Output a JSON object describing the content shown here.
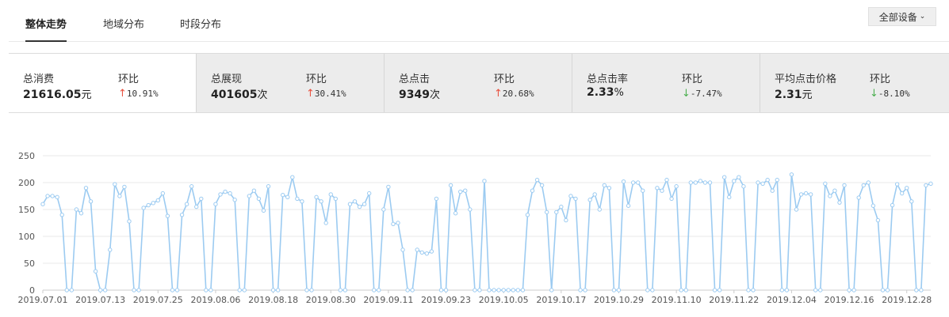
{
  "tabs": [
    {
      "label": "整体走势",
      "active": true
    },
    {
      "label": "地域分布",
      "active": false
    },
    {
      "label": "时段分布",
      "active": false
    }
  ],
  "device_filter": {
    "label": "全部设备",
    "icon": "chevron-down-icon"
  },
  "metrics": [
    {
      "label": "总消费",
      "value": "21616.05",
      "unit": "元",
      "ratio_label": "环比",
      "direction": "up",
      "change": "10.91%",
      "active": true
    },
    {
      "label": "总展现",
      "value": "401605",
      "unit": "次",
      "ratio_label": "环比",
      "direction": "up",
      "change": "30.41%",
      "active": false
    },
    {
      "label": "总点击",
      "value": "9349",
      "unit": "次",
      "ratio_label": "环比",
      "direction": "up",
      "change": "20.68%",
      "active": false
    },
    {
      "label": "总点击率",
      "value": "2.33",
      "unit": "%",
      "ratio_label": "环比",
      "direction": "down",
      "change": "-7.47%",
      "active": false
    },
    {
      "label": "平均点击价格",
      "value": "2.31",
      "unit": "元",
      "ratio_label": "环比",
      "direction": "down",
      "change": "-8.10%",
      "active": false
    }
  ],
  "colors": {
    "line": "#9ccbf1",
    "up": "#e8513f",
    "down": "#4caf50",
    "grid": "#e9e9e9"
  },
  "chart_data": {
    "type": "line",
    "title": "",
    "xlabel": "",
    "ylabel": "",
    "ylim": [
      0,
      250
    ],
    "yticks": [
      0,
      50,
      100,
      150,
      200,
      250
    ],
    "grid": true,
    "x_start": "2019.07.01",
    "x_tick_labels": [
      "2019.07.01",
      "2019.07.13",
      "2019.07.25",
      "2019.08.06",
      "2019.08.18",
      "2019.08.30",
      "2019.09.11",
      "2019.09.23",
      "2019.10.05",
      "2019.10.17",
      "2019.10.29",
      "2019.11.10",
      "2019.11.22",
      "2019.12.04",
      "2019.12.16",
      "2019.12.28"
    ],
    "series": [
      {
        "values": [
          160,
          175,
          175,
          173,
          140,
          0,
          0,
          150,
          143,
          190,
          165,
          35,
          0,
          0,
          75,
          197,
          175,
          192,
          128,
          0,
          0,
          153,
          158,
          162,
          167,
          180,
          138,
          0,
          0,
          140,
          160,
          193,
          155,
          170,
          0,
          0,
          160,
          178,
          183,
          180,
          168,
          0,
          0,
          175,
          185,
          170,
          148,
          193,
          0,
          0,
          177,
          173,
          210,
          170,
          165,
          0,
          0,
          173,
          165,
          125,
          178,
          170,
          0,
          0,
          160,
          165,
          155,
          160,
          180,
          0,
          0,
          150,
          192,
          123,
          125,
          75,
          0,
          0,
          75,
          70,
          68,
          72,
          170,
          0,
          0,
          195,
          143,
          183,
          185,
          150,
          0,
          0,
          203,
          0,
          0,
          0,
          0,
          0,
          0,
          0,
          0,
          140,
          185,
          205,
          195,
          145,
          0,
          145,
          155,
          130,
          175,
          170,
          0,
          0,
          168,
          178,
          150,
          195,
          190,
          0,
          0,
          202,
          157,
          200,
          200,
          185,
          0,
          0,
          190,
          185,
          205,
          170,
          193,
          0,
          0,
          200,
          200,
          203,
          200,
          200,
          0,
          0,
          210,
          173,
          203,
          210,
          193,
          0,
          0,
          200,
          198,
          205,
          185,
          205,
          0,
          0,
          215,
          150,
          178,
          180,
          178,
          0,
          0,
          198,
          175,
          185,
          163,
          195,
          0,
          0,
          172,
          195,
          200,
          157,
          130,
          0,
          0,
          158,
          197,
          180,
          190,
          165,
          0,
          0,
          195,
          198
        ]
      }
    ]
  }
}
